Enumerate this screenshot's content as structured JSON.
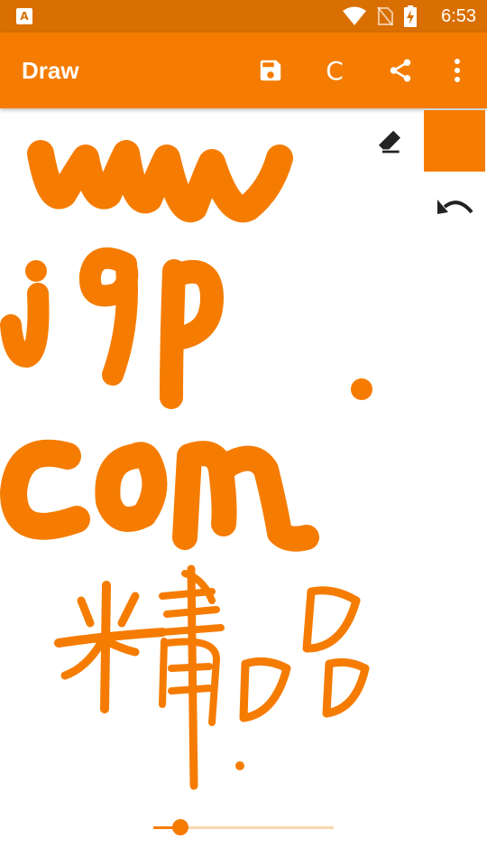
{
  "status_bar": {
    "app_badge": "A",
    "time": "6:53",
    "icons": [
      "wifi-icon",
      "no-sim-icon",
      "battery-charging-icon"
    ]
  },
  "app_bar": {
    "title": "Draw",
    "actions": [
      {
        "name": "save-button",
        "icon": "save-icon"
      },
      {
        "name": "clear-button",
        "label": "C"
      },
      {
        "name": "share-button",
        "icon": "share-icon"
      },
      {
        "name": "overflow-menu-button",
        "icon": "more-vertical-icon"
      }
    ]
  },
  "tools": {
    "eraser_icon": "eraser-icon",
    "undo_icon": "undo-icon",
    "current_color": "#f57c00"
  },
  "brush_size_slider": {
    "value_fraction": 0.15
  },
  "colors": {
    "status_bar": "#d96f00",
    "app_bar": "#f57c00",
    "stroke": "#f57c00",
    "slider_track": "#fbd6ad"
  }
}
